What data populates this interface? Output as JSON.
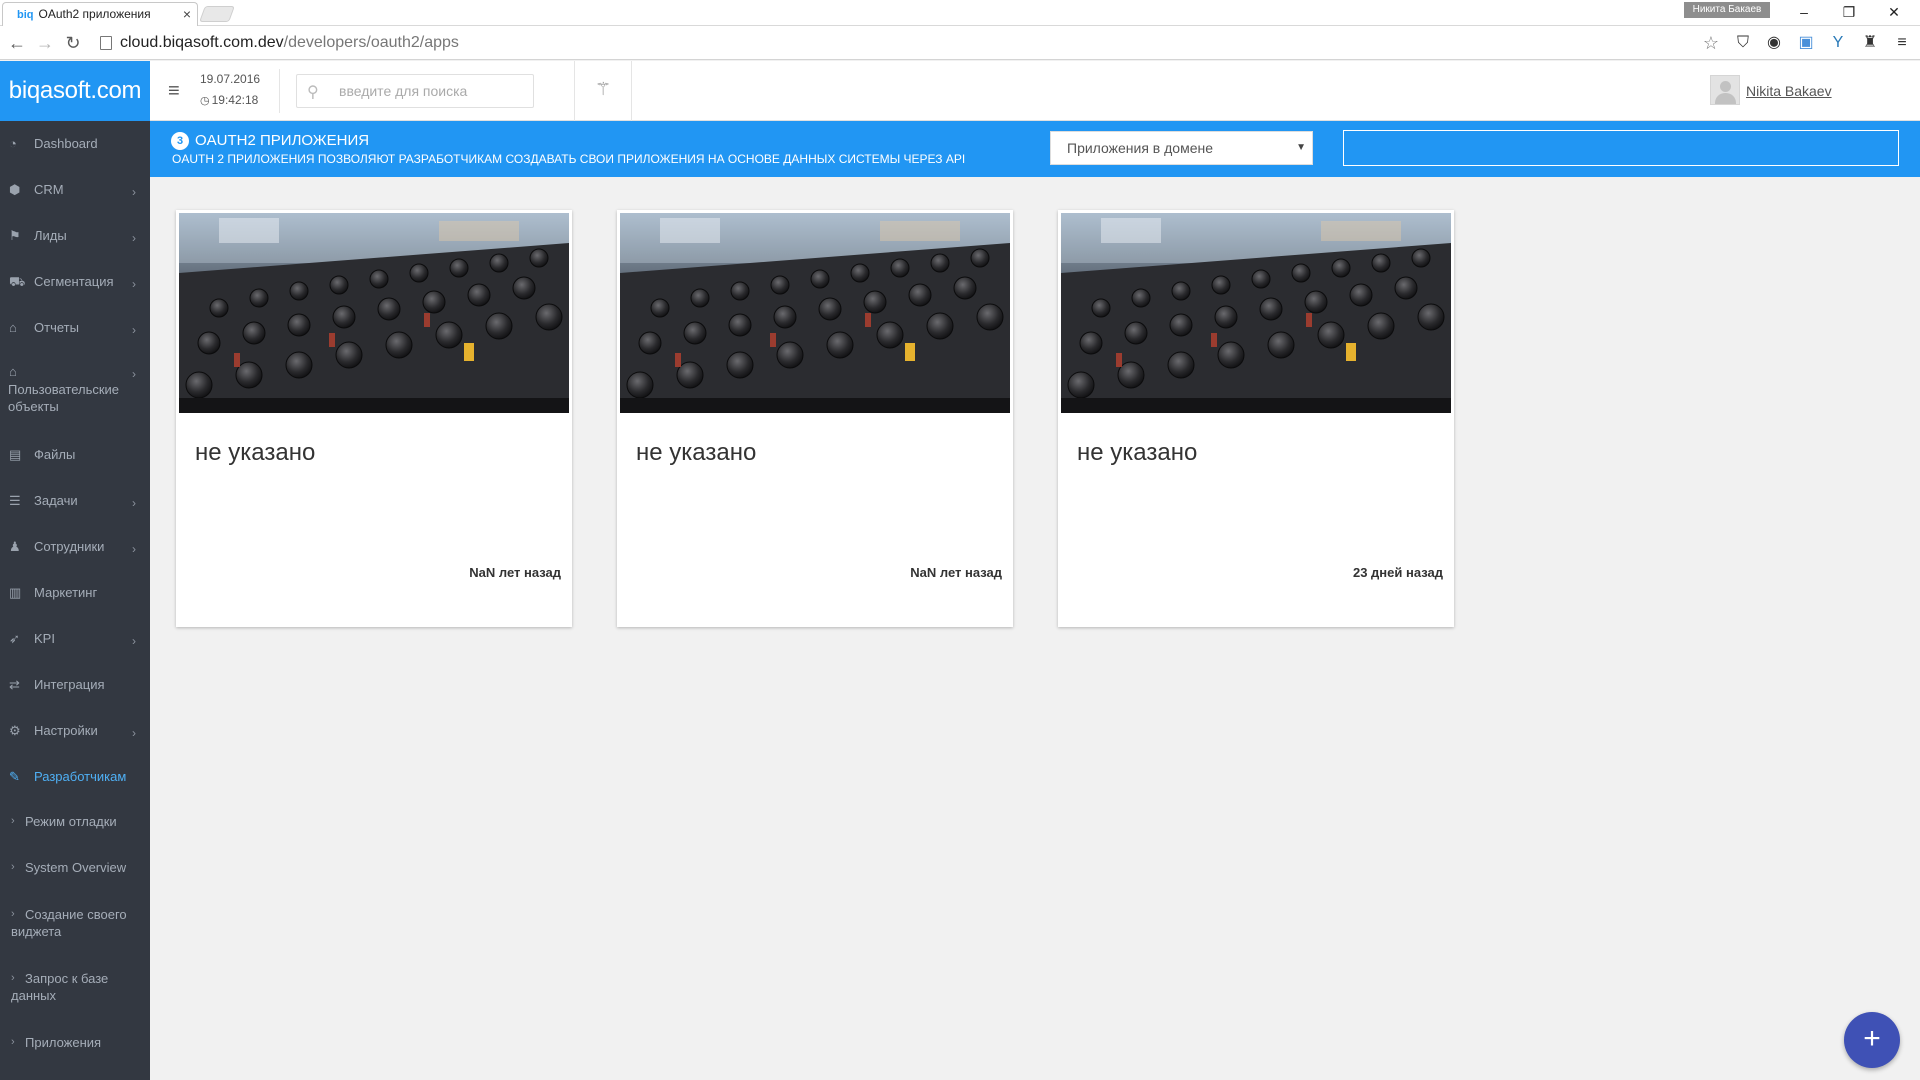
{
  "browser": {
    "tab_title": "OAuth2 приложения",
    "tab_favicon": "biq",
    "profile_name": "Никита Бакаев",
    "url_host": "cloud.biqasoft.com.dev",
    "url_path": "/developers/oauth2/apps"
  },
  "header": {
    "brand": "biqasoft.com",
    "date": "19.07.2016",
    "time": "19:42:18",
    "search_placeholder": "введите для поиска",
    "user_name": "Nikita Bakaev"
  },
  "sidebar": {
    "items": [
      {
        "label": "Dashboard",
        "icon": "dashboard-icon",
        "has_children": false
      },
      {
        "label": "CRM",
        "icon": "cube-icon",
        "has_children": true
      },
      {
        "label": "Лиды",
        "icon": "flag-icon",
        "has_children": true
      },
      {
        "label": "Сегментация",
        "icon": "cart-icon",
        "has_children": true
      },
      {
        "label": "Отчеты",
        "icon": "bank-icon",
        "has_children": true
      },
      {
        "label": "Пользовательские объекты",
        "icon": "bank-icon",
        "has_children": true
      },
      {
        "label": "Файлы",
        "icon": "file-icon",
        "has_children": false
      },
      {
        "label": "Задачи",
        "icon": "tasks-icon",
        "has_children": true
      },
      {
        "label": "Сотрудники",
        "icon": "users-icon",
        "has_children": true
      },
      {
        "label": "Маркетинг",
        "icon": "bar-chart-icon",
        "has_children": false
      },
      {
        "label": "KPI",
        "icon": "rocket-icon",
        "has_children": true
      },
      {
        "label": "Интеграция",
        "icon": "exchange-icon",
        "has_children": false
      },
      {
        "label": "Настройки",
        "icon": "gear-icon",
        "has_children": true
      },
      {
        "label": "Разработчикам",
        "icon": "wrench-icon",
        "has_children": false,
        "active": true
      }
    ],
    "subitems": [
      {
        "label": "Режим отладки"
      },
      {
        "label": "System Overview"
      },
      {
        "label": "Создание своего виджета"
      },
      {
        "label": "Запрос к базе данных"
      },
      {
        "label": "Приложения"
      }
    ]
  },
  "banner": {
    "count": "3",
    "title": "OAUTH2 ПРИЛОЖЕНИЯ",
    "subtitle": "OAUTH 2 ПРИЛОЖЕНИЯ ПОЗВОЛЯЮТ РАЗРАБОТЧИКАМ СОЗДАВАТЬ СВОИ ПРИЛОЖЕНИЯ НА ОСНОВЕ ДАННЫХ СИСТЕМЫ ЧЕРЕЗ API",
    "select_value": "Приложения в домене",
    "filter_value": ""
  },
  "cards": [
    {
      "title": "не указано",
      "time": "NaN лет назад"
    },
    {
      "title": "не указано",
      "time": "NaN лет назад"
    },
    {
      "title": "не указано",
      "time": "23 дней назад"
    }
  ],
  "fab": {
    "label": "+"
  },
  "colors": {
    "brand": "#2196f3",
    "sidebar_bg": "#333841",
    "sidebar_active": "#4fb0f5",
    "fab": "#3f51b5",
    "page_bg": "#f1f1f1"
  }
}
